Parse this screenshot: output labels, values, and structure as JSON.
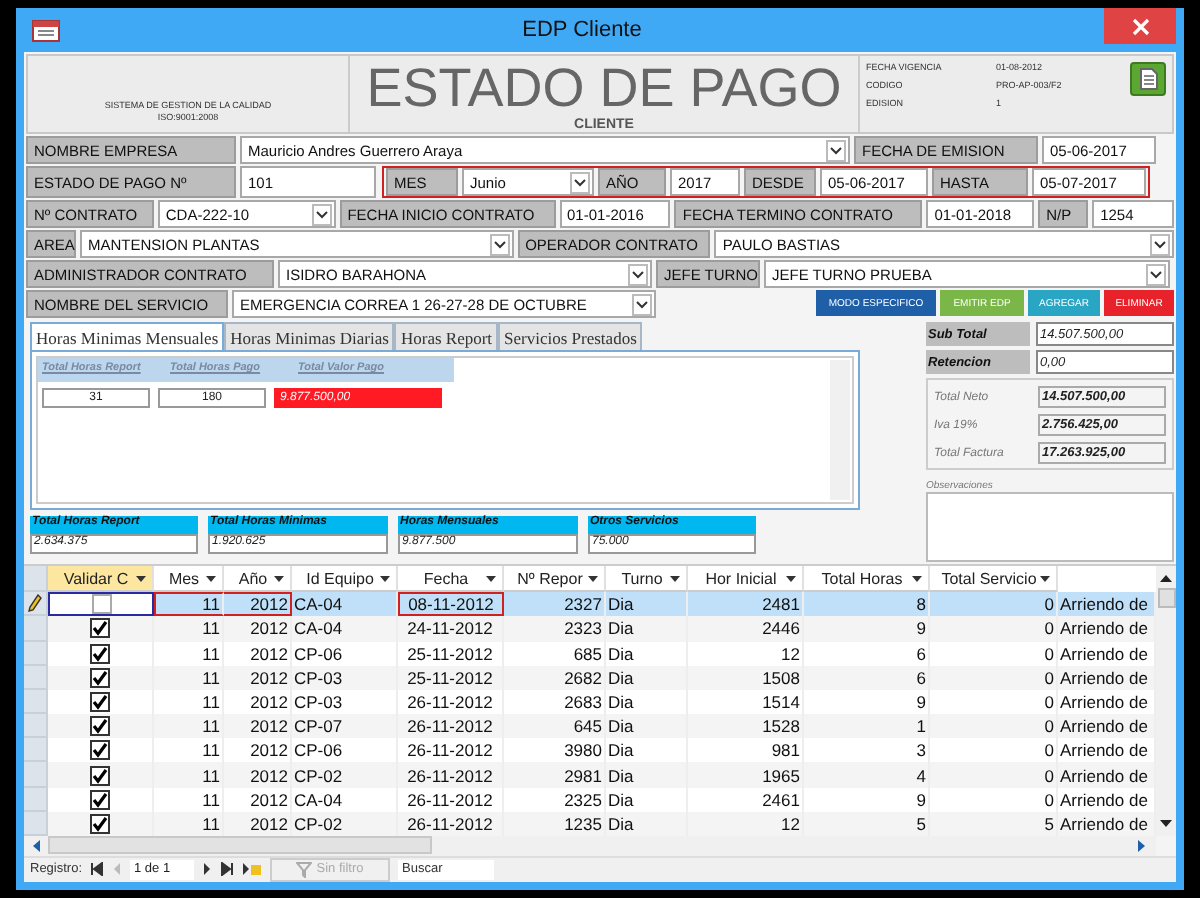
{
  "window": {
    "title": "EDP Cliente"
  },
  "header": {
    "org_lines": [
      "SISTEMA DE GESTION DE LA CALIDAD",
      "ISO:9001:2008"
    ],
    "title": "ESTADO DE PAGO",
    "subtitle": "CLIENTE",
    "meta": [
      {
        "label": "FECHA VIGENCIA",
        "value": "01-08-2012"
      },
      {
        "label": "CODIGO",
        "value": "PRO-AP-003/F2"
      },
      {
        "label": "EDISION",
        "value": "1"
      }
    ]
  },
  "form": {
    "lines": [
      {
        "items": [
          {
            "kind": "label",
            "text": "NOMBRE EMPRESA"
          },
          {
            "kind": "combo",
            "value": "Mauricio Andres Guerrero Araya"
          },
          {
            "kind": "label",
            "text": "FECHA DE EMISION"
          },
          {
            "kind": "field",
            "value": "05-06-2017"
          }
        ]
      },
      {
        "items": [
          {
            "kind": "label",
            "text": "ESTADO DE PAGO Nº"
          },
          {
            "kind": "field",
            "value": "101"
          },
          {
            "kind": "group",
            "items": [
              {
                "kind": "label",
                "text": "MES"
              },
              {
                "kind": "combo",
                "value": "Junio"
              },
              {
                "kind": "label",
                "text": "AÑO"
              },
              {
                "kind": "field",
                "value": "2017"
              },
              {
                "kind": "label",
                "text": "DESDE"
              },
              {
                "kind": "field",
                "value": "05-06-2017"
              },
              {
                "kind": "label",
                "text": "HASTA"
              },
              {
                "kind": "field",
                "value": "05-07-2017"
              }
            ]
          }
        ]
      },
      {
        "items": [
          {
            "kind": "label",
            "text": "Nº CONTRATO"
          },
          {
            "kind": "combo",
            "value": "CDA-222-10"
          },
          {
            "kind": "label",
            "text": "FECHA INICIO CONTRATO"
          },
          {
            "kind": "field",
            "value": "01-01-2016"
          },
          {
            "kind": "label",
            "text": "FECHA TERMINO CONTRATO"
          },
          {
            "kind": "field",
            "value": "01-01-2018"
          },
          {
            "kind": "label",
            "text": "N/P"
          },
          {
            "kind": "field",
            "value": "1254"
          }
        ]
      },
      {
        "items": [
          {
            "kind": "label",
            "text": "AREA"
          },
          {
            "kind": "combo",
            "value": "MANTENSION PLANTAS"
          },
          {
            "kind": "label",
            "text": "OPERADOR CONTRATO"
          },
          {
            "kind": "combo",
            "value": "PAULO BASTIAS"
          }
        ]
      },
      {
        "items": [
          {
            "kind": "label",
            "text": "ADMINISTRADOR CONTRATO"
          },
          {
            "kind": "combo",
            "value": "ISIDRO BARAHONA"
          },
          {
            "kind": "label",
            "text": "JEFE TURNO"
          },
          {
            "kind": "combo",
            "value": "JEFE TURNO PRUEBA"
          }
        ]
      },
      {
        "items": [
          {
            "kind": "label",
            "text": "NOMBRE DEL SERVICIO"
          },
          {
            "kind": "combo",
            "value": "EMERGENCIA CORREA 1 26-27-28 DE OCTUBRE"
          },
          {
            "kind": "button",
            "text": "MODO ESPECIFICO",
            "color": "#1f5fa8"
          },
          {
            "kind": "button",
            "text": "EMITIR EDP",
            "color": "#7ab648"
          },
          {
            "kind": "button",
            "text": "AGREGAR",
            "color": "#2aa6c4"
          },
          {
            "kind": "button",
            "text": "ELIMINAR",
            "color": "#e8222a"
          }
        ]
      }
    ]
  },
  "tabs": [
    {
      "label": "Horas Minimas Mensuales",
      "selected": true
    },
    {
      "label": "Horas Minimas Diarias",
      "selected": false
    },
    {
      "label": "Horas Report",
      "selected": false
    },
    {
      "label": "Servicios Prestados",
      "selected": false
    }
  ],
  "subform": {
    "columns": [
      "Total Horas Report",
      "Total Horas Pago",
      "Total Valor Pago"
    ],
    "values": [
      {
        "value": "31",
        "alert": false
      },
      {
        "value": "180",
        "alert": false
      },
      {
        "value": "9.877.500,00",
        "alert": true
      }
    ]
  },
  "summaries": [
    {
      "label": "Total Horas Report",
      "value": "2.634.375"
    },
    {
      "label": "Total Horas Minimas",
      "value": "1.920.625"
    },
    {
      "label": "Horas Mensuales",
      "value": "9.877.500"
    },
    {
      "label": "Otros Servicios",
      "value": "75.000"
    }
  ],
  "totals": {
    "sub_total": {
      "label": "Sub Total",
      "value": "14.507.500,00"
    },
    "retencion": {
      "label": "Retencion",
      "value": "0,00"
    },
    "breakdown": [
      {
        "label": "Total Neto",
        "value": "14.507.500,00"
      },
      {
        "label": "Iva 19%",
        "value": "2.756.425,00"
      },
      {
        "label": "Total Factura",
        "value": "17.263.925,00"
      }
    ],
    "observaciones": {
      "label": "Observaciones"
    }
  },
  "table": {
    "check_column": {
      "label": "Validar C",
      "current": true
    },
    "columns": [
      {
        "label": "Mes",
        "current": false
      },
      {
        "label": "Año",
        "current": false
      },
      {
        "label": "Id Equipo",
        "current": false
      },
      {
        "label": "Fecha",
        "current": false
      },
      {
        "label": "Nº Repor",
        "current": false
      },
      {
        "label": "Turno",
        "current": false
      },
      {
        "label": "Hor Inicial",
        "current": false
      },
      {
        "label": "Total Horas",
        "current": false
      },
      {
        "label": "Total Servicio",
        "current": false
      }
    ],
    "rows": [
      {
        "selected": true,
        "validated": false,
        "cells": [
          "11",
          "2012",
          "CA-04",
          "08-11-2012",
          "2327",
          "Dia",
          "2481",
          "8",
          "0",
          "Arriendo de"
        ]
      },
      {
        "selected": false,
        "validated": true,
        "cells": [
          "11",
          "2012",
          "CA-04",
          "24-11-2012",
          "2323",
          "Dia",
          "2446",
          "9",
          "0",
          "Arriendo de"
        ]
      },
      {
        "selected": false,
        "validated": true,
        "cells": [
          "11",
          "2012",
          "CP-06",
          "25-11-2012",
          "685",
          "Dia",
          "12",
          "6",
          "0",
          "Arriendo de"
        ]
      },
      {
        "selected": false,
        "validated": true,
        "cells": [
          "11",
          "2012",
          "CP-03",
          "25-11-2012",
          "2682",
          "Dia",
          "1508",
          "6",
          "0",
          "Arriendo de"
        ]
      },
      {
        "selected": false,
        "validated": true,
        "cells": [
          "11",
          "2012",
          "CP-03",
          "26-11-2012",
          "2683",
          "Dia",
          "1514",
          "9",
          "0",
          "Arriendo de"
        ]
      },
      {
        "selected": false,
        "validated": true,
        "cells": [
          "11",
          "2012",
          "CP-07",
          "26-11-2012",
          "645",
          "Dia",
          "1528",
          "1",
          "0",
          "Arriendo de"
        ]
      },
      {
        "selected": false,
        "validated": true,
        "cells": [
          "11",
          "2012",
          "CP-06",
          "26-11-2012",
          "3980",
          "Dia",
          "981",
          "3",
          "0",
          "Arriendo de"
        ]
      },
      {
        "selected": false,
        "validated": true,
        "cells": [
          "11",
          "2012",
          "CP-02",
          "26-11-2012",
          "2981",
          "Dia",
          "1965",
          "4",
          "0",
          "Arriendo de"
        ]
      },
      {
        "selected": false,
        "validated": true,
        "cells": [
          "11",
          "2012",
          "CA-04",
          "26-11-2012",
          "2325",
          "Dia",
          "2461",
          "9",
          "0",
          "Arriendo de"
        ]
      },
      {
        "selected": false,
        "validated": true,
        "cells": [
          "11",
          "2012",
          "CP-02",
          "26-11-2012",
          "1235",
          "Dia",
          "12",
          "5",
          "5",
          "Arriendo de"
        ]
      }
    ]
  },
  "navigation": {
    "label": "Registro:",
    "position": "1 de 1",
    "filter": "Sin filtro",
    "search": {
      "placeholder": "Buscar"
    }
  }
}
